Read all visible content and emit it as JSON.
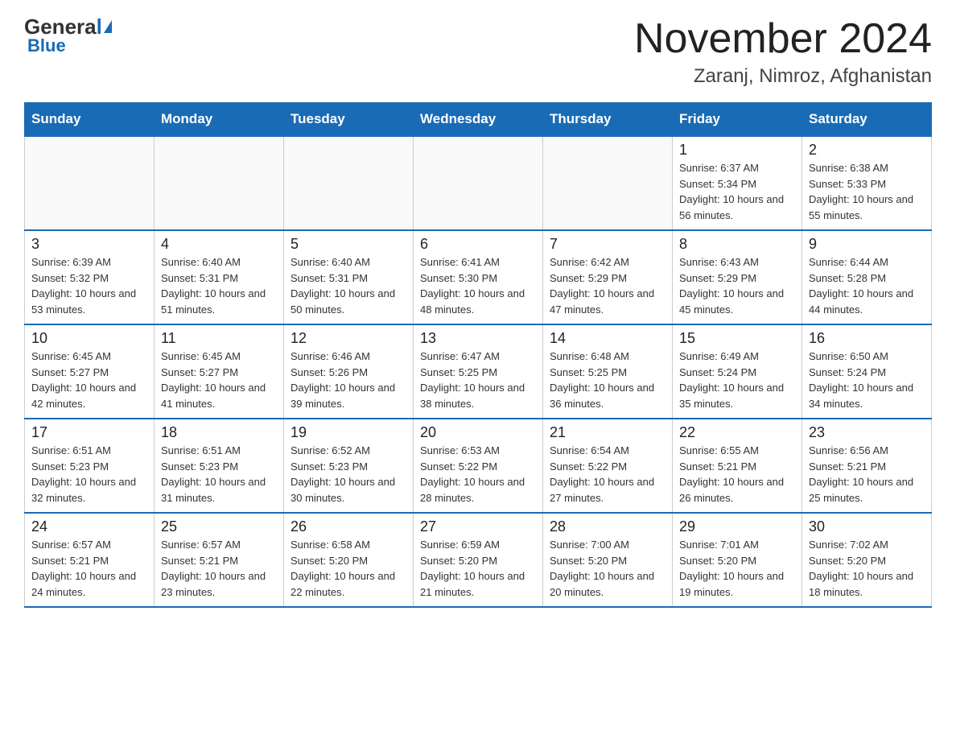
{
  "header": {
    "logo_general": "General",
    "logo_blue": "Blue",
    "title": "November 2024",
    "subtitle": "Zaranj, Nimroz, Afghanistan"
  },
  "calendar": {
    "days_of_week": [
      "Sunday",
      "Monday",
      "Tuesday",
      "Wednesday",
      "Thursday",
      "Friday",
      "Saturday"
    ],
    "weeks": [
      [
        {
          "day": "",
          "info": ""
        },
        {
          "day": "",
          "info": ""
        },
        {
          "day": "",
          "info": ""
        },
        {
          "day": "",
          "info": ""
        },
        {
          "day": "",
          "info": ""
        },
        {
          "day": "1",
          "info": "Sunrise: 6:37 AM\nSunset: 5:34 PM\nDaylight: 10 hours and 56 minutes."
        },
        {
          "day": "2",
          "info": "Sunrise: 6:38 AM\nSunset: 5:33 PM\nDaylight: 10 hours and 55 minutes."
        }
      ],
      [
        {
          "day": "3",
          "info": "Sunrise: 6:39 AM\nSunset: 5:32 PM\nDaylight: 10 hours and 53 minutes."
        },
        {
          "day": "4",
          "info": "Sunrise: 6:40 AM\nSunset: 5:31 PM\nDaylight: 10 hours and 51 minutes."
        },
        {
          "day": "5",
          "info": "Sunrise: 6:40 AM\nSunset: 5:31 PM\nDaylight: 10 hours and 50 minutes."
        },
        {
          "day": "6",
          "info": "Sunrise: 6:41 AM\nSunset: 5:30 PM\nDaylight: 10 hours and 48 minutes."
        },
        {
          "day": "7",
          "info": "Sunrise: 6:42 AM\nSunset: 5:29 PM\nDaylight: 10 hours and 47 minutes."
        },
        {
          "day": "8",
          "info": "Sunrise: 6:43 AM\nSunset: 5:29 PM\nDaylight: 10 hours and 45 minutes."
        },
        {
          "day": "9",
          "info": "Sunrise: 6:44 AM\nSunset: 5:28 PM\nDaylight: 10 hours and 44 minutes."
        }
      ],
      [
        {
          "day": "10",
          "info": "Sunrise: 6:45 AM\nSunset: 5:27 PM\nDaylight: 10 hours and 42 minutes."
        },
        {
          "day": "11",
          "info": "Sunrise: 6:45 AM\nSunset: 5:27 PM\nDaylight: 10 hours and 41 minutes."
        },
        {
          "day": "12",
          "info": "Sunrise: 6:46 AM\nSunset: 5:26 PM\nDaylight: 10 hours and 39 minutes."
        },
        {
          "day": "13",
          "info": "Sunrise: 6:47 AM\nSunset: 5:25 PM\nDaylight: 10 hours and 38 minutes."
        },
        {
          "day": "14",
          "info": "Sunrise: 6:48 AM\nSunset: 5:25 PM\nDaylight: 10 hours and 36 minutes."
        },
        {
          "day": "15",
          "info": "Sunrise: 6:49 AM\nSunset: 5:24 PM\nDaylight: 10 hours and 35 minutes."
        },
        {
          "day": "16",
          "info": "Sunrise: 6:50 AM\nSunset: 5:24 PM\nDaylight: 10 hours and 34 minutes."
        }
      ],
      [
        {
          "day": "17",
          "info": "Sunrise: 6:51 AM\nSunset: 5:23 PM\nDaylight: 10 hours and 32 minutes."
        },
        {
          "day": "18",
          "info": "Sunrise: 6:51 AM\nSunset: 5:23 PM\nDaylight: 10 hours and 31 minutes."
        },
        {
          "day": "19",
          "info": "Sunrise: 6:52 AM\nSunset: 5:23 PM\nDaylight: 10 hours and 30 minutes."
        },
        {
          "day": "20",
          "info": "Sunrise: 6:53 AM\nSunset: 5:22 PM\nDaylight: 10 hours and 28 minutes."
        },
        {
          "day": "21",
          "info": "Sunrise: 6:54 AM\nSunset: 5:22 PM\nDaylight: 10 hours and 27 minutes."
        },
        {
          "day": "22",
          "info": "Sunrise: 6:55 AM\nSunset: 5:21 PM\nDaylight: 10 hours and 26 minutes."
        },
        {
          "day": "23",
          "info": "Sunrise: 6:56 AM\nSunset: 5:21 PM\nDaylight: 10 hours and 25 minutes."
        }
      ],
      [
        {
          "day": "24",
          "info": "Sunrise: 6:57 AM\nSunset: 5:21 PM\nDaylight: 10 hours and 24 minutes."
        },
        {
          "day": "25",
          "info": "Sunrise: 6:57 AM\nSunset: 5:21 PM\nDaylight: 10 hours and 23 minutes."
        },
        {
          "day": "26",
          "info": "Sunrise: 6:58 AM\nSunset: 5:20 PM\nDaylight: 10 hours and 22 minutes."
        },
        {
          "day": "27",
          "info": "Sunrise: 6:59 AM\nSunset: 5:20 PM\nDaylight: 10 hours and 21 minutes."
        },
        {
          "day": "28",
          "info": "Sunrise: 7:00 AM\nSunset: 5:20 PM\nDaylight: 10 hours and 20 minutes."
        },
        {
          "day": "29",
          "info": "Sunrise: 7:01 AM\nSunset: 5:20 PM\nDaylight: 10 hours and 19 minutes."
        },
        {
          "day": "30",
          "info": "Sunrise: 7:02 AM\nSunset: 5:20 PM\nDaylight: 10 hours and 18 minutes."
        }
      ]
    ]
  }
}
